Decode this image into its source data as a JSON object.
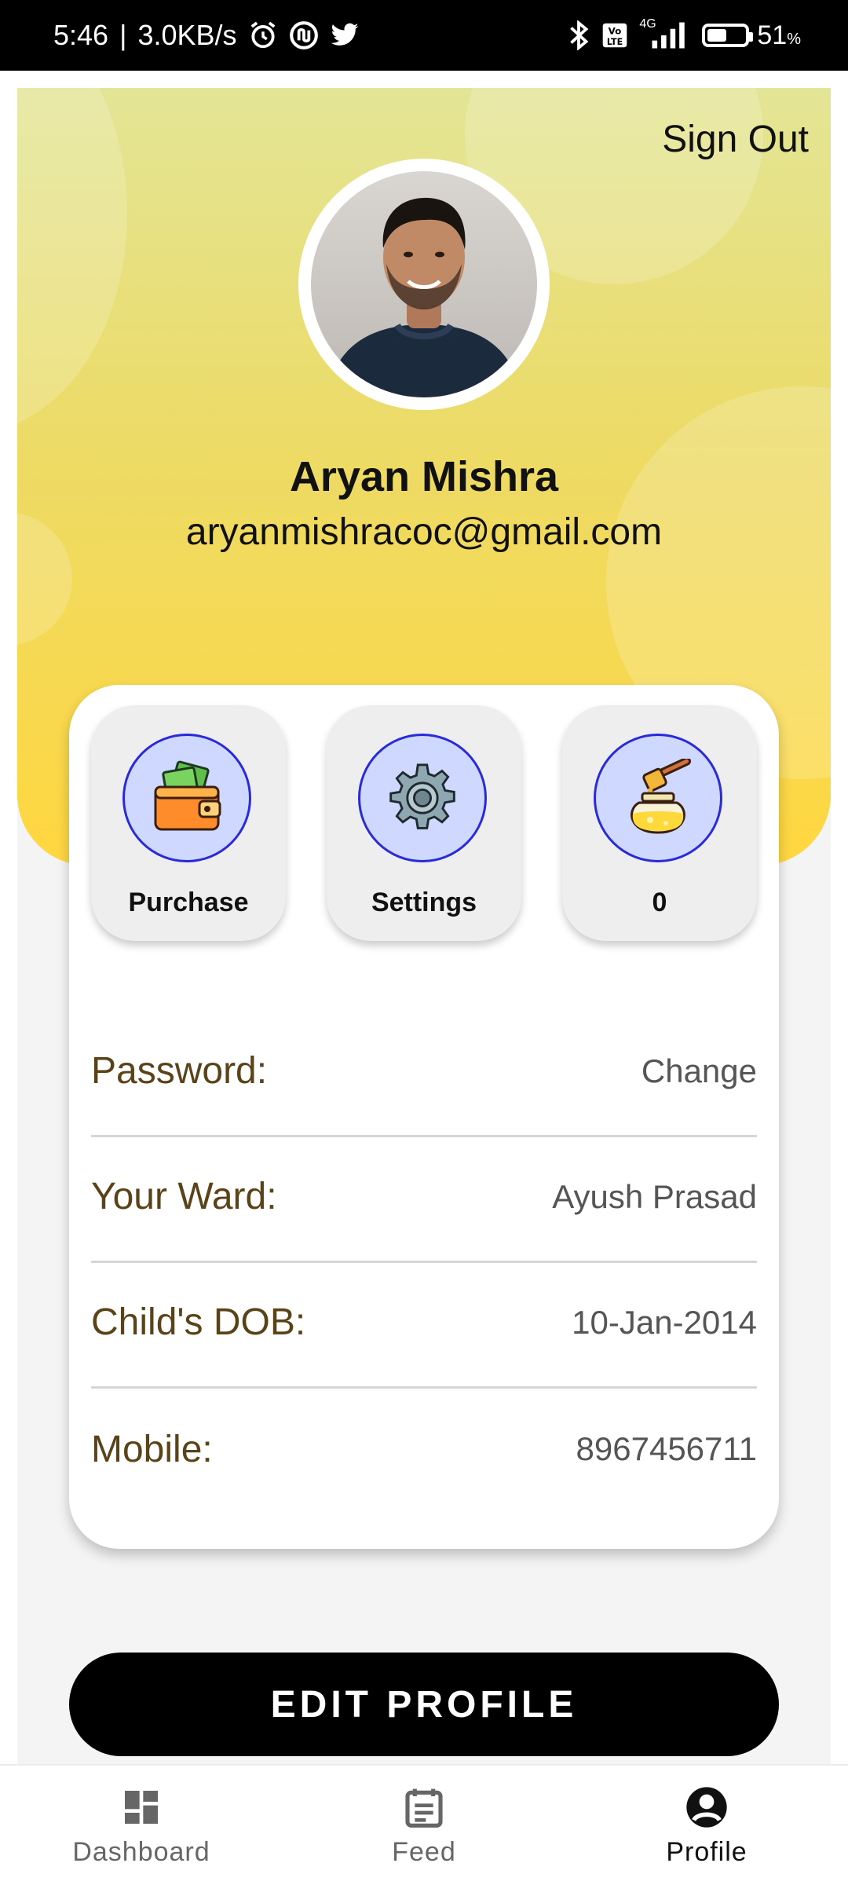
{
  "status_bar": {
    "time": "5:46",
    "separator": "|",
    "speed": "3.0KB/s",
    "network_type": "4G",
    "volte": "Vo LTE",
    "battery_percent": "51",
    "battery_percent_sign": "%",
    "battery_level": 0.51,
    "icons": [
      "alarm-icon",
      "app-notification-icon",
      "twitter-icon",
      "bluetooth-icon",
      "volte-icon",
      "signal-icon",
      "battery-icon"
    ]
  },
  "header": {
    "sign_out_label": "Sign Out"
  },
  "profile": {
    "name": "Aryan Mishra",
    "email": "aryanmishracoc@gmail.com"
  },
  "tiles": [
    {
      "label": "Purchase",
      "icon": "wallet-icon"
    },
    {
      "label": "Settings",
      "icon": "gear-icon"
    },
    {
      "label": "0",
      "icon": "honey-jar-icon"
    }
  ],
  "details": [
    {
      "label": "Password:",
      "value": "Change"
    },
    {
      "label": "Your Ward:",
      "value": "Ayush Prasad"
    },
    {
      "label": "Child's DOB:",
      "value": "10-Jan-2014"
    },
    {
      "label": "Mobile:",
      "value": "8967456711"
    }
  ],
  "edit_button_label": "EDIT PROFILE",
  "nav": [
    {
      "label": "Dashboard",
      "icon": "dashboard-icon",
      "active": false
    },
    {
      "label": "Feed",
      "icon": "feed-icon",
      "active": false
    },
    {
      "label": "Profile",
      "icon": "profile-icon",
      "active": true
    }
  ],
  "colors": {
    "accent_yellow": "#ffd740",
    "tile_icon_bg": "#cfd8ff",
    "tile_icon_border": "#2a2ad8",
    "label_brown": "#5a4318"
  }
}
